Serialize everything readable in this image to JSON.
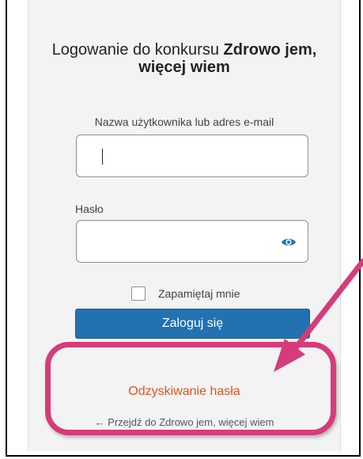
{
  "login": {
    "title_prefix": "Logowanie do konkursu ",
    "title_bold": "Zdrowo jem, więcej wiem",
    "username_label": "Nazwa użytkownika lub adres e-mail",
    "username_value": "",
    "password_label": "Hasło",
    "password_value": "",
    "remember_label": "Zapamiętaj mnie",
    "submit_label": "Zaloguj się",
    "lost_password_link": "Odzyskiwanie hasła",
    "back_link": "← Przejdź do Zdrowo jem, więcej wiem"
  },
  "colors": {
    "annotation": "#d63b7a",
    "primary_button": "#2271b1",
    "link_orange": "#e0541b"
  },
  "icons": {
    "password_toggle": "eye-icon"
  }
}
